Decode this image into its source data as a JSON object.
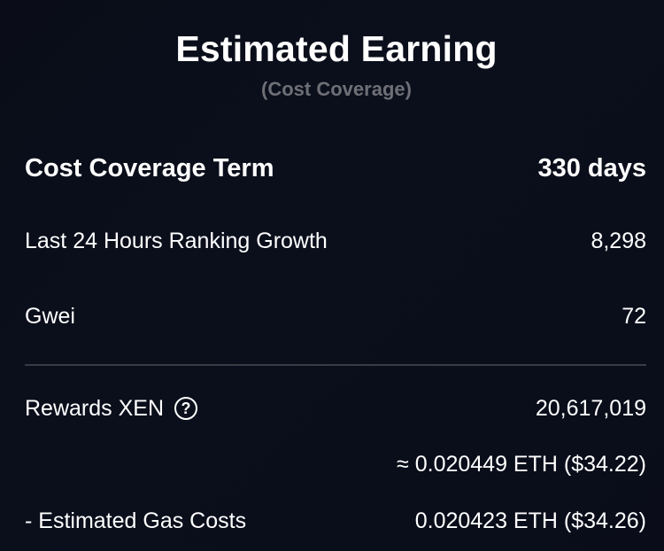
{
  "header": {
    "title": "Estimated Earning",
    "subtitle": "(Cost Coverage)"
  },
  "term": {
    "label": "Cost Coverage Term",
    "value": "330 days"
  },
  "stats": {
    "ranking_growth": {
      "label": "Last 24 Hours Ranking Growth",
      "value": "8,298"
    },
    "gwei": {
      "label": "Gwei",
      "value": "72"
    }
  },
  "rewards": {
    "label": "Rewards XEN",
    "help_icon": "?",
    "value": "20,617,019",
    "conversion": "≈ 0.020449 ETH ($34.22)"
  },
  "gas": {
    "label": "- Estimated Gas Costs",
    "value": "0.020423 ETH ($34.26)"
  },
  "icons": {
    "help": "question-circle-icon"
  },
  "colors": {
    "background": "#0b0e1a",
    "text": "#ffffff",
    "subtitle": "#6e6f76",
    "divider": "#3a3c45"
  }
}
